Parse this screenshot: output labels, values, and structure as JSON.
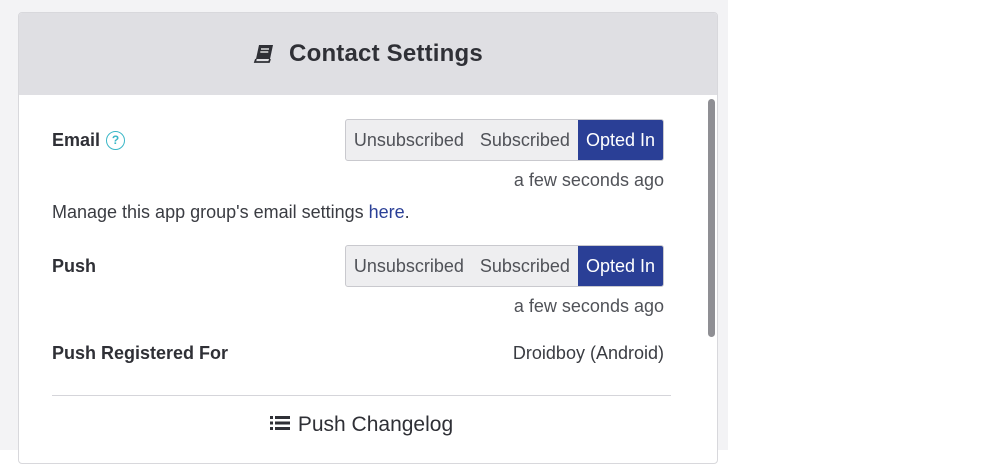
{
  "panel": {
    "title": "Contact Settings",
    "header_icon": "book-icon"
  },
  "email": {
    "label": "Email",
    "help_icon_text": "?",
    "options": [
      "Unsubscribed",
      "Subscribed",
      "Opted In"
    ],
    "selected": "Opted In",
    "timestamp": "a few seconds ago",
    "manage_prefix": "Manage this app group's email settings ",
    "manage_link": "here",
    "manage_suffix": "."
  },
  "push": {
    "label": "Push",
    "options": [
      "Unsubscribed",
      "Subscribed",
      "Opted In"
    ],
    "selected": "Opted In",
    "timestamp": "a few seconds ago"
  },
  "push_registered": {
    "label": "Push Registered For",
    "value": "Droidboy (Android)"
  },
  "changelog": {
    "label": "Push Changelog",
    "icon": "list-icon"
  },
  "colors": {
    "accent": "#2a3f96",
    "help": "#3ab7c7",
    "header_bg": "#dfdfe3"
  }
}
